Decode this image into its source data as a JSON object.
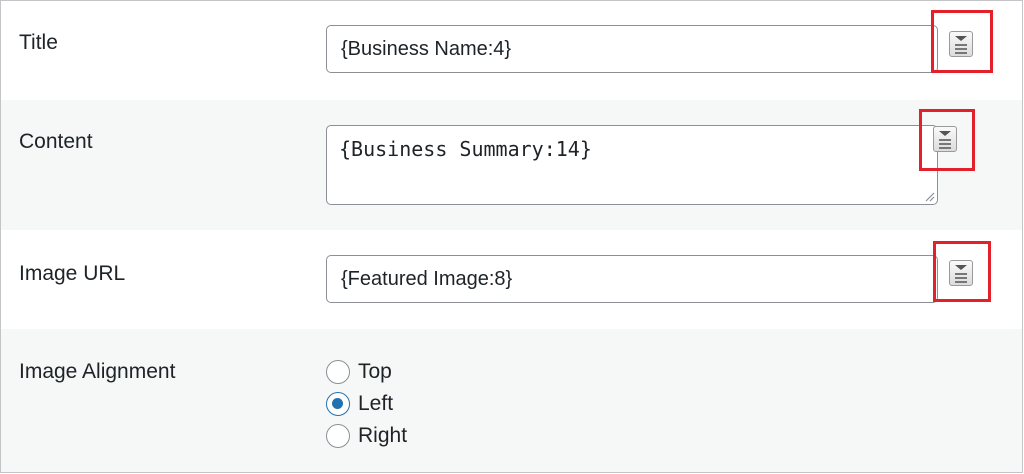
{
  "fields": {
    "title": {
      "label": "Title",
      "value": "{Business Name:4}"
    },
    "content": {
      "label": "Content",
      "value": "{Business Summary:14}"
    },
    "image_url": {
      "label": "Image URL",
      "value": "{Featured Image:8}"
    },
    "image_alignment": {
      "label": "Image Alignment",
      "options": [
        {
          "label": "Top",
          "checked": false
        },
        {
          "label": "Left",
          "checked": true
        },
        {
          "label": "Right",
          "checked": false
        }
      ]
    }
  },
  "icons": {
    "merge_tag": "merge-tag-icon",
    "resize": "resize-handle-icon"
  },
  "colors": {
    "highlight": "#e3212b",
    "radio_checked": "#2271b1",
    "row_alt": "#f6f7f7"
  }
}
